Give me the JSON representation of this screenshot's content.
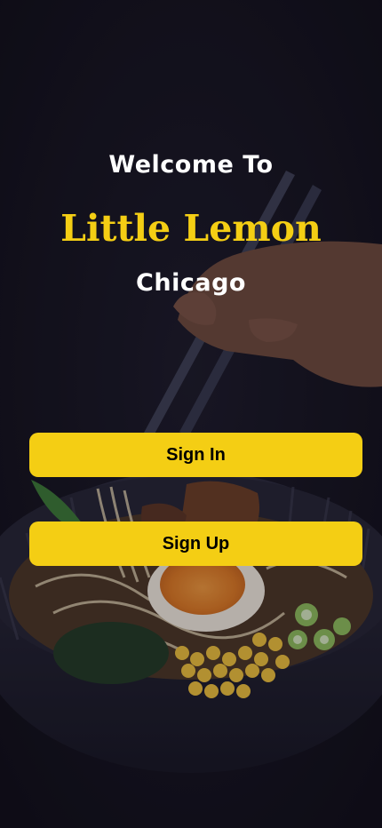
{
  "welcome_text": "Welcome To",
  "brand_name": "Little Lemon",
  "city": "Chicago",
  "buttons": {
    "sign_in": "Sign In",
    "sign_up": "Sign Up"
  },
  "colors": {
    "accent": "#F4CE14",
    "background": "#12111A",
    "text_light": "#FFFFFF",
    "button_text": "#000000"
  },
  "background_image": "ramen-bowl-with-chopsticks"
}
